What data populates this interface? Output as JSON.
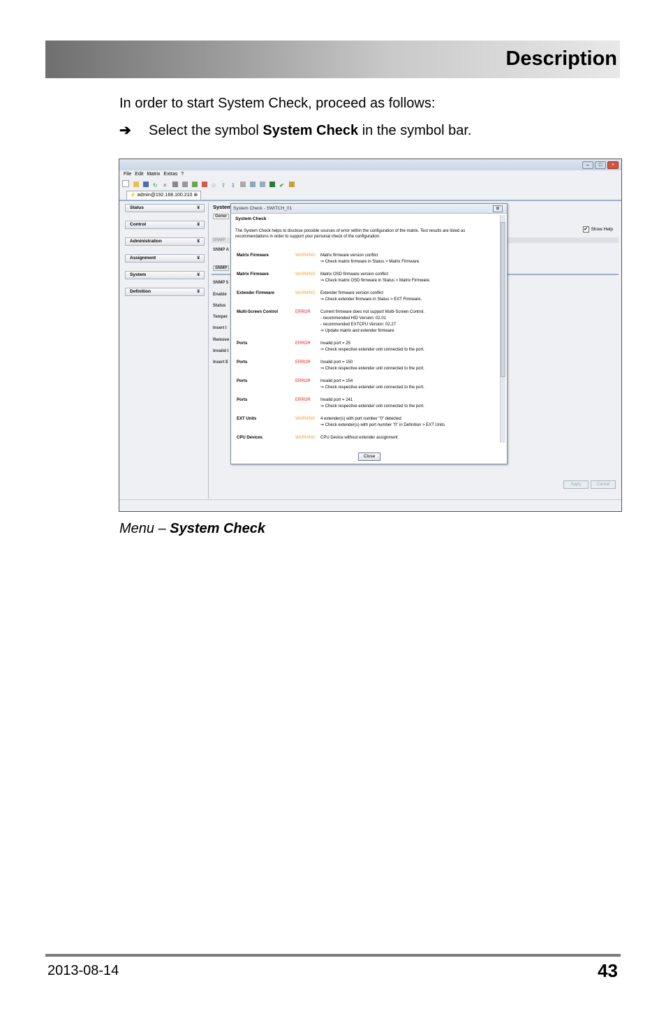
{
  "header": {
    "title": "Description"
  },
  "intro": "In order to start System Check, proceed as follows:",
  "step": {
    "arrow": "➔",
    "before": "Select the symbol ",
    "bold": "System Check",
    "after": " in the symbol bar."
  },
  "screenshot": {
    "menu": [
      "File",
      "Edit",
      "Matrix",
      "Extras",
      "?"
    ],
    "connection_tab": "admin@192.168.100.210",
    "sidebar": [
      "Status",
      "Control",
      "Administration",
      "Assignment",
      "System",
      "Definition"
    ],
    "content_title": "System",
    "content_labels": [
      "Gener",
      "SNMP",
      "SNMP A",
      "SNMP",
      "SNMP 5",
      "Enable",
      "Status",
      "Temper",
      "Insert I",
      "Remove",
      "Invalid I",
      "Insert E"
    ],
    "show_help": "Show Help",
    "apply": "Apply",
    "cancel": "Cancel",
    "dialog": {
      "title": "System Check - SWITCH_01",
      "heading": "System Check",
      "description": "The System Check helps to disclose possible sources of error within the configuration of the matrix. Test results are listed as recommendations in order to support your personal check of the configuration.",
      "rows": [
        {
          "category": "Matrix Firmware",
          "severity": "WARNING",
          "message": "Matrix firmware version conflict\n⇒ Check matrix firmware in Status > Matrix Firmware."
        },
        {
          "category": "Matrix Firmware",
          "severity": "WARNING",
          "message": "Matrix OSD firmware version conflict\n⇒ Check matrix OSD firmware in Status > Matrix Firmware."
        },
        {
          "category": "Extender Firmware",
          "severity": "WARNING",
          "message": "Extender firmware version conflict\n⇒ Check extender firmware in Status > EXT Firmware."
        },
        {
          "category": "Multi-Screen Control",
          "severity": "ERROR",
          "message": "Current firmware does not support Multi-Screen Control.\n- recommended HID Version: 02.01\n- recommended EXTCPU Version: 02.27\n⇒ Update matrix and extender firmware"
        },
        {
          "category": "Ports",
          "severity": "ERROR",
          "message": "Invalid port = 25\n⇒ Check respective extender unit connected to the port."
        },
        {
          "category": "Ports",
          "severity": "ERROR",
          "message": "Invalid port = 150\n⇒ Check respective extender unit connected to the port."
        },
        {
          "category": "Ports",
          "severity": "ERROR",
          "message": "Invalid port = 154\n⇒ Check respective extender unit connected to the port."
        },
        {
          "category": "Ports",
          "severity": "ERROR",
          "message": "Invalid port = 241\n⇒ Check respective extender unit connected to the port."
        },
        {
          "category": "EXT Units",
          "severity": "WARNING",
          "message": "4 extender(s) with port number \"0\" detected\n⇒ Check extender(s) with port number \"0\" in Definition > EXT Units"
        },
        {
          "category": "CPU Devices",
          "severity": "WARNING",
          "message": "CPU Device without extender assignment"
        }
      ],
      "close": "Close"
    }
  },
  "caption": {
    "prefix": "Menu – ",
    "bold": "System Check"
  },
  "footer": {
    "date": "2013-08-14",
    "page": "43"
  },
  "colors": {
    "warning": "#f0a030",
    "error": "#e02020"
  }
}
